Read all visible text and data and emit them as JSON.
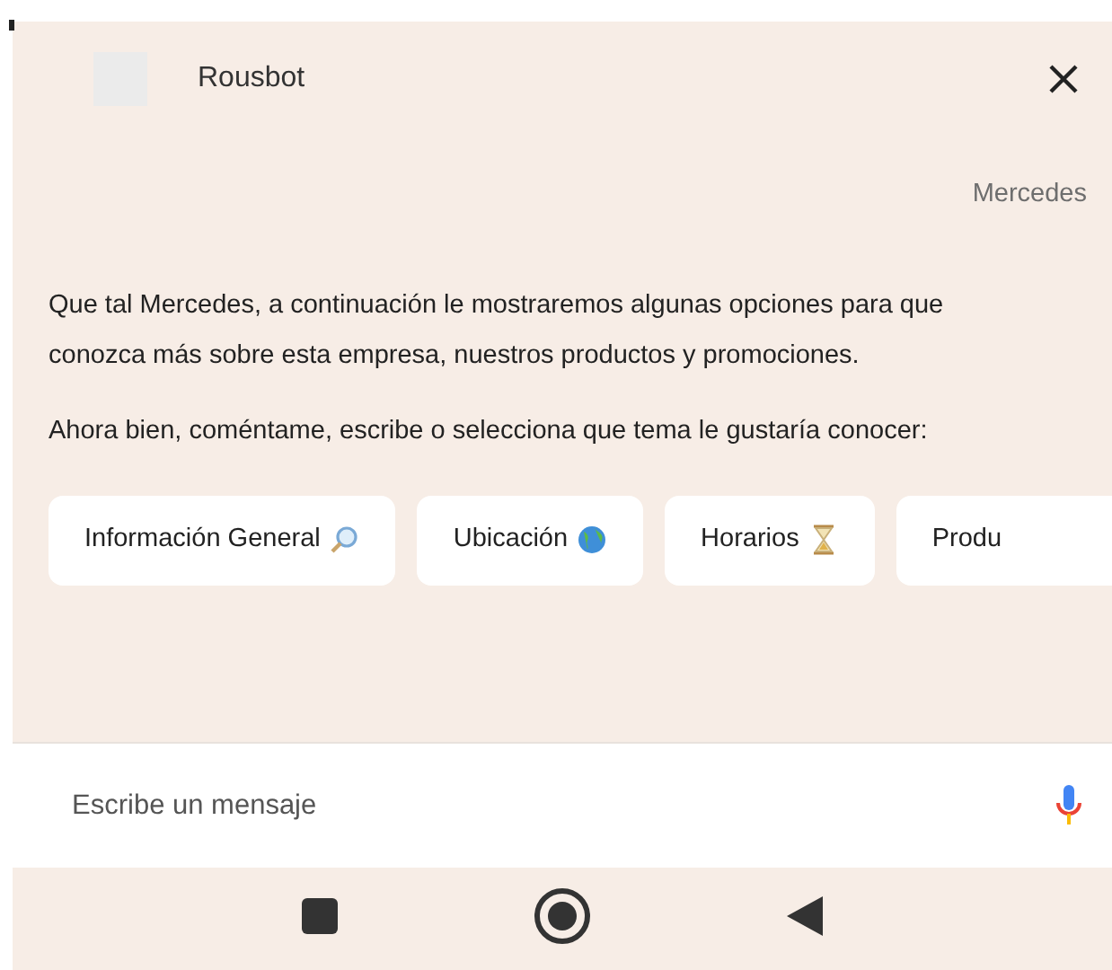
{
  "header": {
    "title": "Rousbot"
  },
  "user_label": "Mercedes",
  "messages": [
    "Que tal Mercedes, a continuación le mostraremos algunas opciones para que conozca más sobre esta empresa, nuestros productos y promociones.",
    "Ahora bien, coméntame, escribe o selecciona que tema le gustaría conocer:"
  ],
  "chips": [
    {
      "label": "Información General",
      "kind": "search"
    },
    {
      "label": "Ubicación",
      "kind": "globe"
    },
    {
      "label": "Horarios",
      "kind": "hourglass"
    },
    {
      "label": "Produ",
      "kind": "none"
    }
  ],
  "composer": {
    "placeholder": "Escribe un mensaje"
  }
}
